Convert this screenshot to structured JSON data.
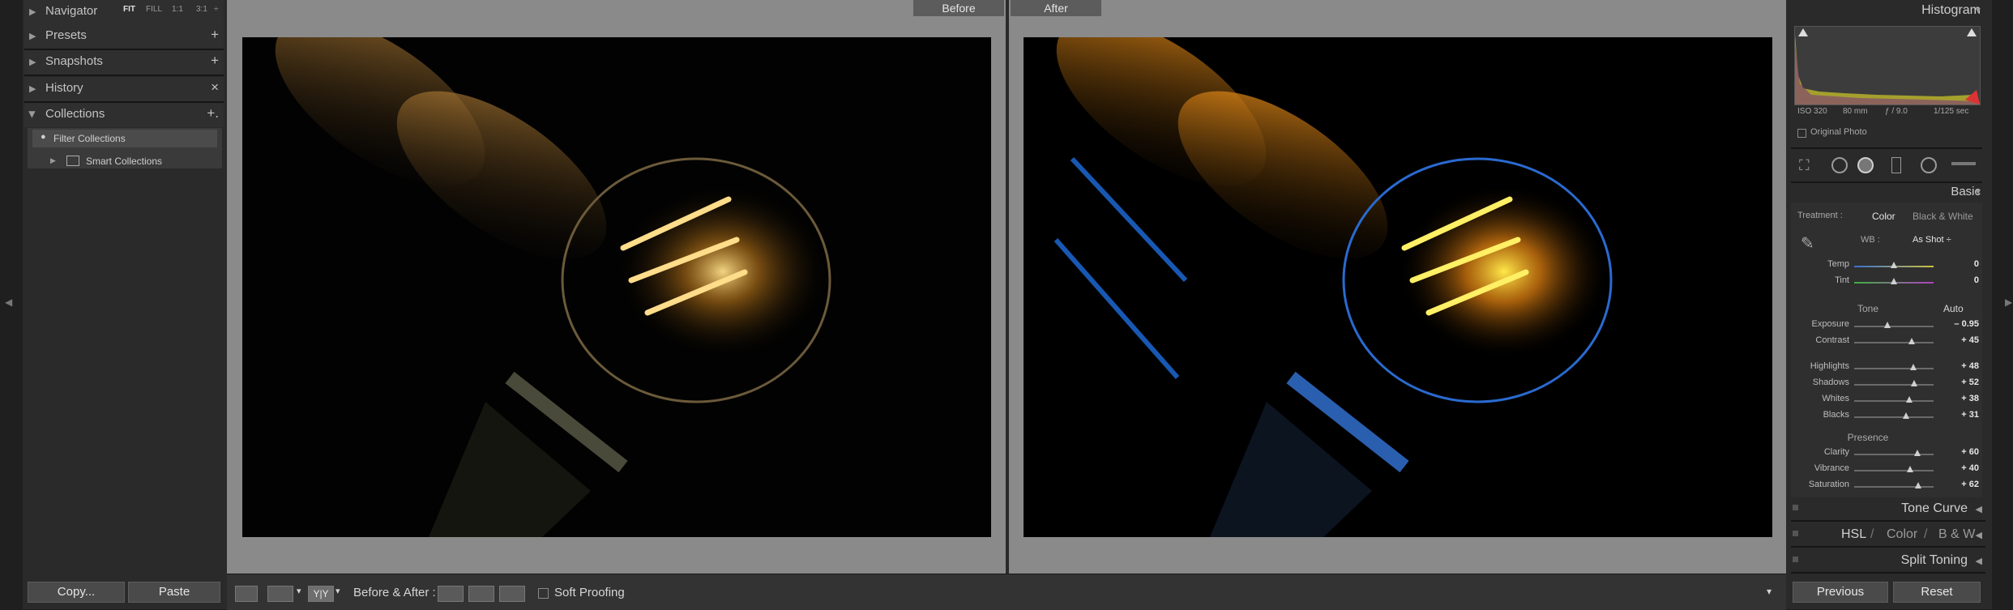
{
  "left_panel": {
    "navigator": {
      "title": "Navigator",
      "zoom": [
        "FIT",
        "FILL",
        "1:1",
        "3:1"
      ],
      "zoom_arrow": "÷"
    },
    "presets": {
      "title": "Presets",
      "action": "+"
    },
    "snapshots": {
      "title": "Snapshots",
      "action": "+"
    },
    "history": {
      "title": "History",
      "action": "×"
    },
    "collections": {
      "title": "Collections",
      "action": "+.",
      "filter": "Filter Collections",
      "smart": "Smart Collections"
    },
    "copy_button": "Copy...",
    "paste_button": "Paste"
  },
  "center": {
    "before_label": "Before",
    "after_label": "After"
  },
  "toolbar": {
    "before_after_label": "Before & After :",
    "yy_label": "Y|Y",
    "soft_proofing_label": "Soft Proofing"
  },
  "right_panel": {
    "histogram": {
      "title": "Histogram",
      "iso": "ISO 320",
      "focal": "80 mm",
      "aperture": "ƒ / 9.0",
      "shutter": "1/125 sec",
      "original_photo": "Original Photo"
    },
    "basic": {
      "title": "Basic",
      "treatment_label": "Treatment :",
      "treatment_color": "Color",
      "treatment_bw": "Black & White",
      "wb_label": "WB :",
      "wb_value": "As Shot ÷",
      "tone_label": "Tone",
      "auto_label": "Auto",
      "presence_label": "Presence",
      "sliders": [
        {
          "label": "Temp",
          "value": "0",
          "pos": 0.5
        },
        {
          "label": "Tint",
          "value": "0",
          "pos": 0.5
        },
        {
          "label": "Exposure",
          "value": "– 0.95",
          "pos": 0.42
        },
        {
          "label": "Contrast",
          "value": "+ 45",
          "pos": 0.72
        },
        {
          "label": "Highlights",
          "value": "+ 48",
          "pos": 0.74
        },
        {
          "label": "Shadows",
          "value": "+ 52",
          "pos": 0.76
        },
        {
          "label": "Whites",
          "value": "+ 38",
          "pos": 0.69
        },
        {
          "label": "Blacks",
          "value": "+ 31",
          "pos": 0.65
        },
        {
          "label": "Clarity",
          "value": "+ 60",
          "pos": 0.8
        },
        {
          "label": "Vibrance",
          "value": "+ 40",
          "pos": 0.7
        },
        {
          "label": "Saturation",
          "value": "+ 62",
          "pos": 0.81
        }
      ]
    },
    "tone_curve": "Tone Curve",
    "hsl": {
      "hsl": "HSL",
      "color": "Color",
      "bw": "B & W",
      "sep": "/"
    },
    "split_toning": "Split Toning",
    "previous_button": "Previous",
    "reset_button": "Reset"
  }
}
